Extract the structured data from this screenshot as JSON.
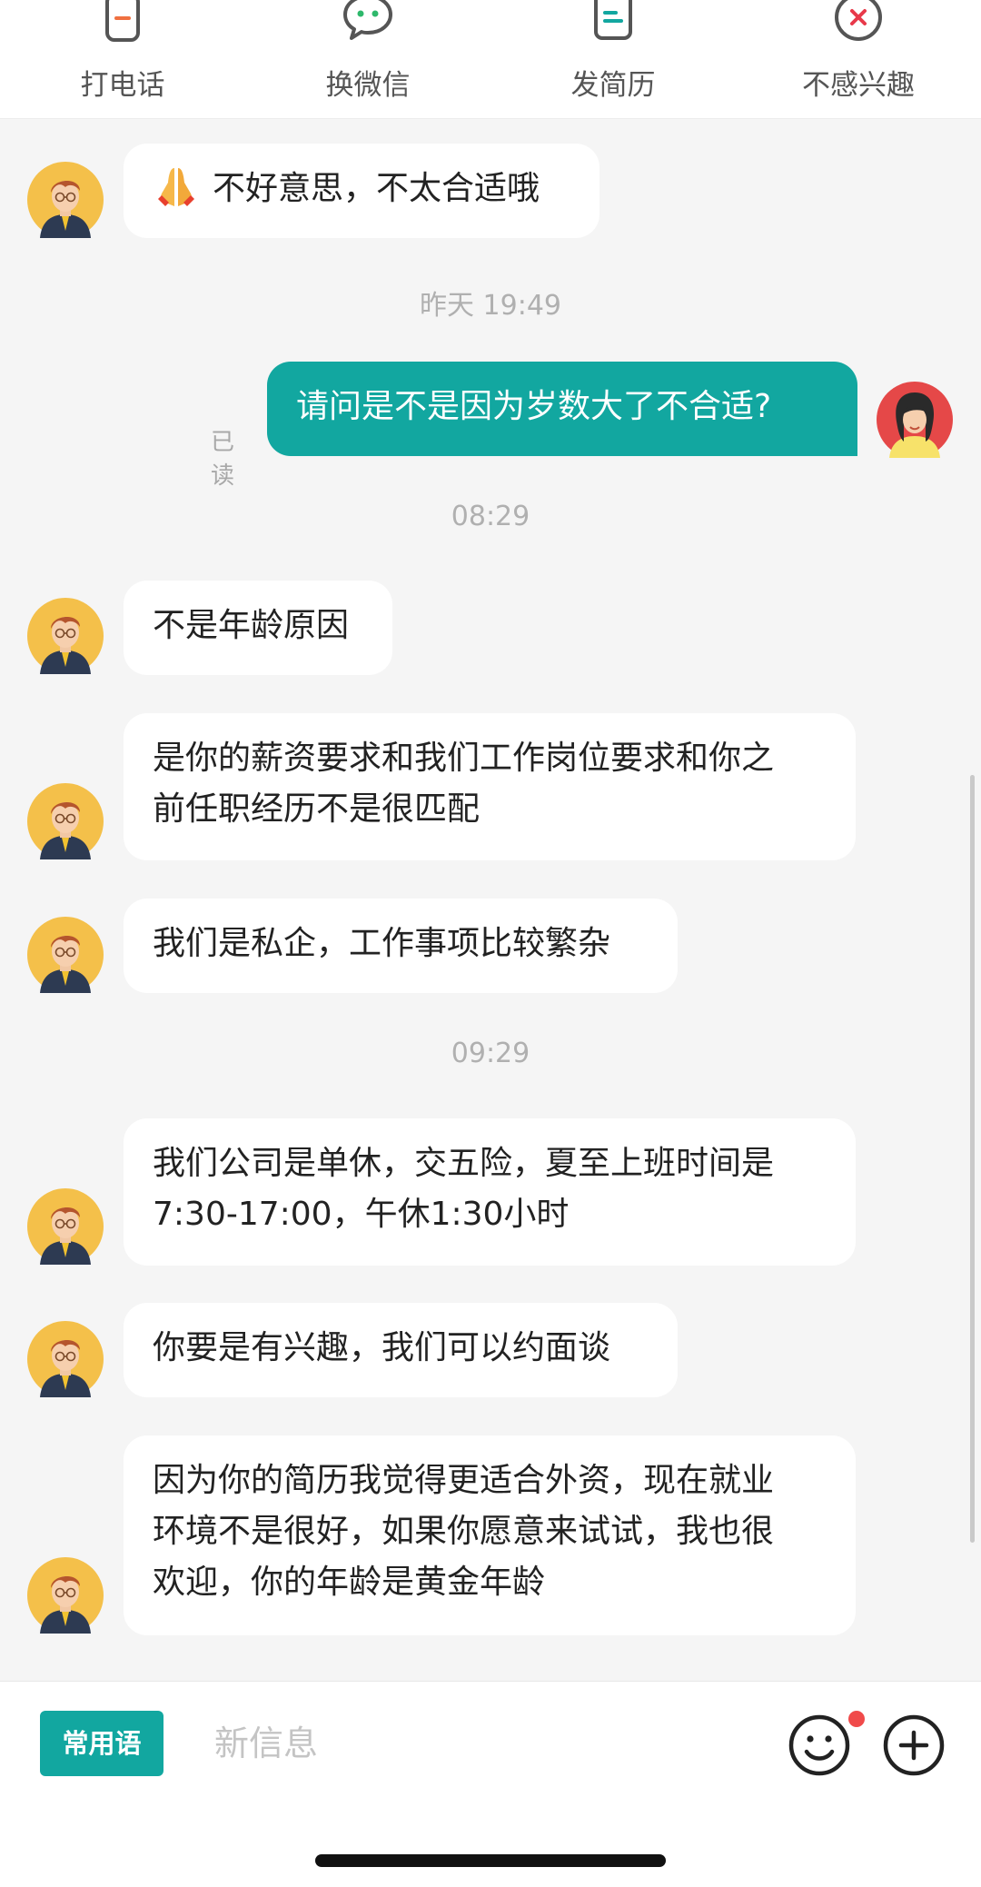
{
  "actions": [
    {
      "label": "打电话",
      "icon": "phone-icon"
    },
    {
      "label": "换微信",
      "icon": "wechat-icon"
    },
    {
      "label": "发简历",
      "icon": "resume-icon"
    },
    {
      "label": "不感兴趣",
      "icon": "not-interested-icon"
    }
  ],
  "messages": {
    "m1": "不好意思，不太合适哦",
    "ts1": "昨天 19:49",
    "m2": "请问是不是因为岁数大了不合适?",
    "m2_status": "已读",
    "ts2": "08:29",
    "m3": "不是年龄原因",
    "m4_l1": "是你的薪资要求和我们工作岗位要求和你之",
    "m4_l2": "前任职经历不是很匹配",
    "m5": "我们是私企，工作事项比较繁杂",
    "ts3": "09:29",
    "m6_l1": "我们公司是单休，交五险，夏至上班时间是",
    "m6_l2": "7:30-17:00，午休1:30小时",
    "m7": "你要是有兴趣，我们可以约面谈",
    "m8_l1": "因为你的简历我觉得更适合外资，现在就业",
    "m8_l2": "环境不是很好，如果你愿意来试试，我也很",
    "m8_l3": "欢迎，你的年龄是黄金年龄"
  },
  "composer": {
    "quick_phrase": "常用语",
    "placeholder": "新信息"
  },
  "colors": {
    "accent": "#12a7a0",
    "badge": "#f04a4a"
  }
}
